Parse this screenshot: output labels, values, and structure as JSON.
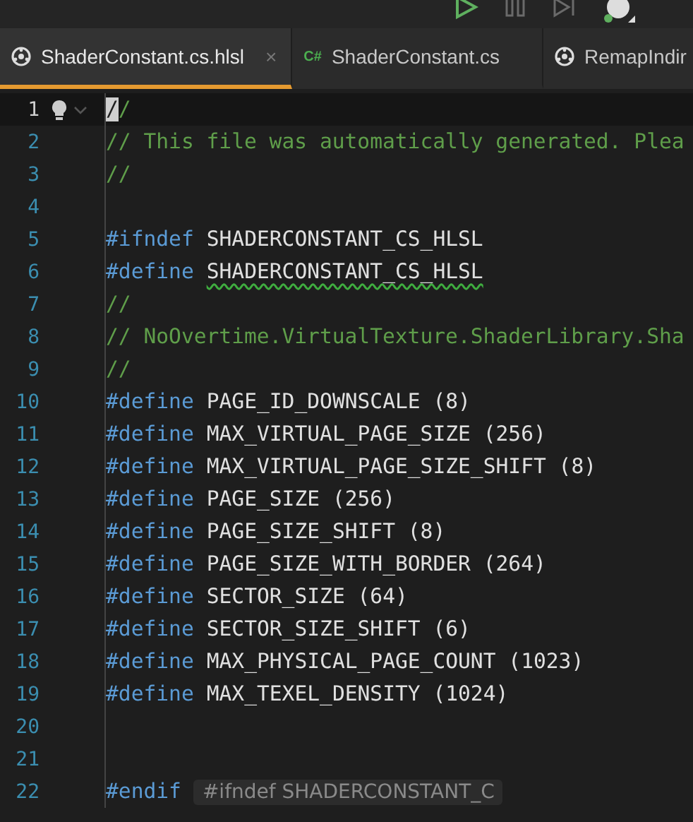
{
  "toolbar": {
    "buttons": [
      {
        "kind": "run",
        "disabled": false
      },
      {
        "kind": "pause",
        "disabled": true
      },
      {
        "kind": "stop",
        "disabled": true
      },
      {
        "kind": "avatar",
        "disabled": false
      }
    ]
  },
  "tabs": [
    {
      "label": "ShaderConstant.cs.hlsl",
      "kind": "shader",
      "selected": true,
      "close": "×"
    },
    {
      "label": "ShaderConstant.cs",
      "kind": "csharp",
      "icon_text": "C#",
      "selected": false
    },
    {
      "label": "RemapIndir",
      "kind": "shader",
      "selected": false
    }
  ],
  "editor": {
    "lines": [
      {
        "number": "1",
        "current": true,
        "tokens": [
          {
            "kind": "comment",
            "text": "//"
          }
        ]
      },
      {
        "number": "2",
        "current": false,
        "tokens": [
          {
            "kind": "comment",
            "text": "// This file was automatically generated. Plea"
          }
        ]
      },
      {
        "number": "3",
        "current": false,
        "tokens": [
          {
            "kind": "comment",
            "text": "//"
          }
        ]
      },
      {
        "number": "4",
        "current": false
      },
      {
        "number": "5",
        "current": false,
        "tokens": [
          {
            "kind": "keyword",
            "text": "#ifndef"
          },
          {
            "kind": "plain",
            "text": "SHADERCONSTANT_CS_HLSL"
          }
        ]
      },
      {
        "number": "6",
        "current": false,
        "tokens": [
          {
            "kind": "keyword",
            "text": "#define"
          },
          {
            "kind": "plain",
            "text": "SHADERCONSTANT_CS_HLSL",
            "squiggle": true
          }
        ]
      },
      {
        "number": "7",
        "current": false,
        "tokens": [
          {
            "kind": "comment",
            "text": "//"
          }
        ]
      },
      {
        "number": "8",
        "current": false,
        "tokens": [
          {
            "kind": "comment",
            "text": "// NoOvertime.VirtualTexture.ShaderLibrary.Sha"
          }
        ]
      },
      {
        "number": "9",
        "current": false,
        "tokens": [
          {
            "kind": "comment",
            "text": "//"
          }
        ]
      },
      {
        "number": "10",
        "current": false,
        "tokens": [
          {
            "kind": "keyword",
            "text": "#define"
          },
          {
            "kind": "plain",
            "text": "PAGE_ID_DOWNSCALE (8)"
          }
        ]
      },
      {
        "number": "11",
        "current": false,
        "tokens": [
          {
            "kind": "keyword",
            "text": "#define"
          },
          {
            "kind": "plain",
            "text": "MAX_VIRTUAL_PAGE_SIZE (256)"
          }
        ]
      },
      {
        "number": "12",
        "current": false,
        "tokens": [
          {
            "kind": "keyword",
            "text": "#define"
          },
          {
            "kind": "plain",
            "text": "MAX_VIRTUAL_PAGE_SIZE_SHIFT (8)"
          }
        ]
      },
      {
        "number": "13",
        "current": false,
        "tokens": [
          {
            "kind": "keyword",
            "text": "#define"
          },
          {
            "kind": "plain",
            "text": "PAGE_SIZE (256)"
          }
        ]
      },
      {
        "number": "14",
        "current": false,
        "tokens": [
          {
            "kind": "keyword",
            "text": "#define"
          },
          {
            "kind": "plain",
            "text": "PAGE_SIZE_SHIFT (8)"
          }
        ]
      },
      {
        "number": "15",
        "current": false,
        "tokens": [
          {
            "kind": "keyword",
            "text": "#define"
          },
          {
            "kind": "plain",
            "text": "PAGE_SIZE_WITH_BORDER (264)"
          }
        ]
      },
      {
        "number": "16",
        "current": false,
        "tokens": [
          {
            "kind": "keyword",
            "text": "#define"
          },
          {
            "kind": "plain",
            "text": "SECTOR_SIZE (64)"
          }
        ]
      },
      {
        "number": "17",
        "current": false,
        "tokens": [
          {
            "kind": "keyword",
            "text": "#define"
          },
          {
            "kind": "plain",
            "text": "SECTOR_SIZE_SHIFT (6)"
          }
        ]
      },
      {
        "number": "18",
        "current": false,
        "tokens": [
          {
            "kind": "keyword",
            "text": "#define"
          },
          {
            "kind": "plain",
            "text": "MAX_PHYSICAL_PAGE_COUNT (1023)"
          }
        ]
      },
      {
        "number": "19",
        "current": false,
        "tokens": [
          {
            "kind": "keyword",
            "text": "#define"
          },
          {
            "kind": "plain",
            "text": "MAX_TEXEL_DENSITY (1024)"
          }
        ]
      },
      {
        "number": "20",
        "current": false
      },
      {
        "number": "21",
        "current": false
      },
      {
        "number": "22",
        "current": false,
        "tokens": [
          {
            "kind": "keyword",
            "text": "#endif"
          },
          {
            "kind": "hint",
            "text": "#ifndef SHADERCONSTANT_C"
          }
        ]
      }
    ]
  }
}
